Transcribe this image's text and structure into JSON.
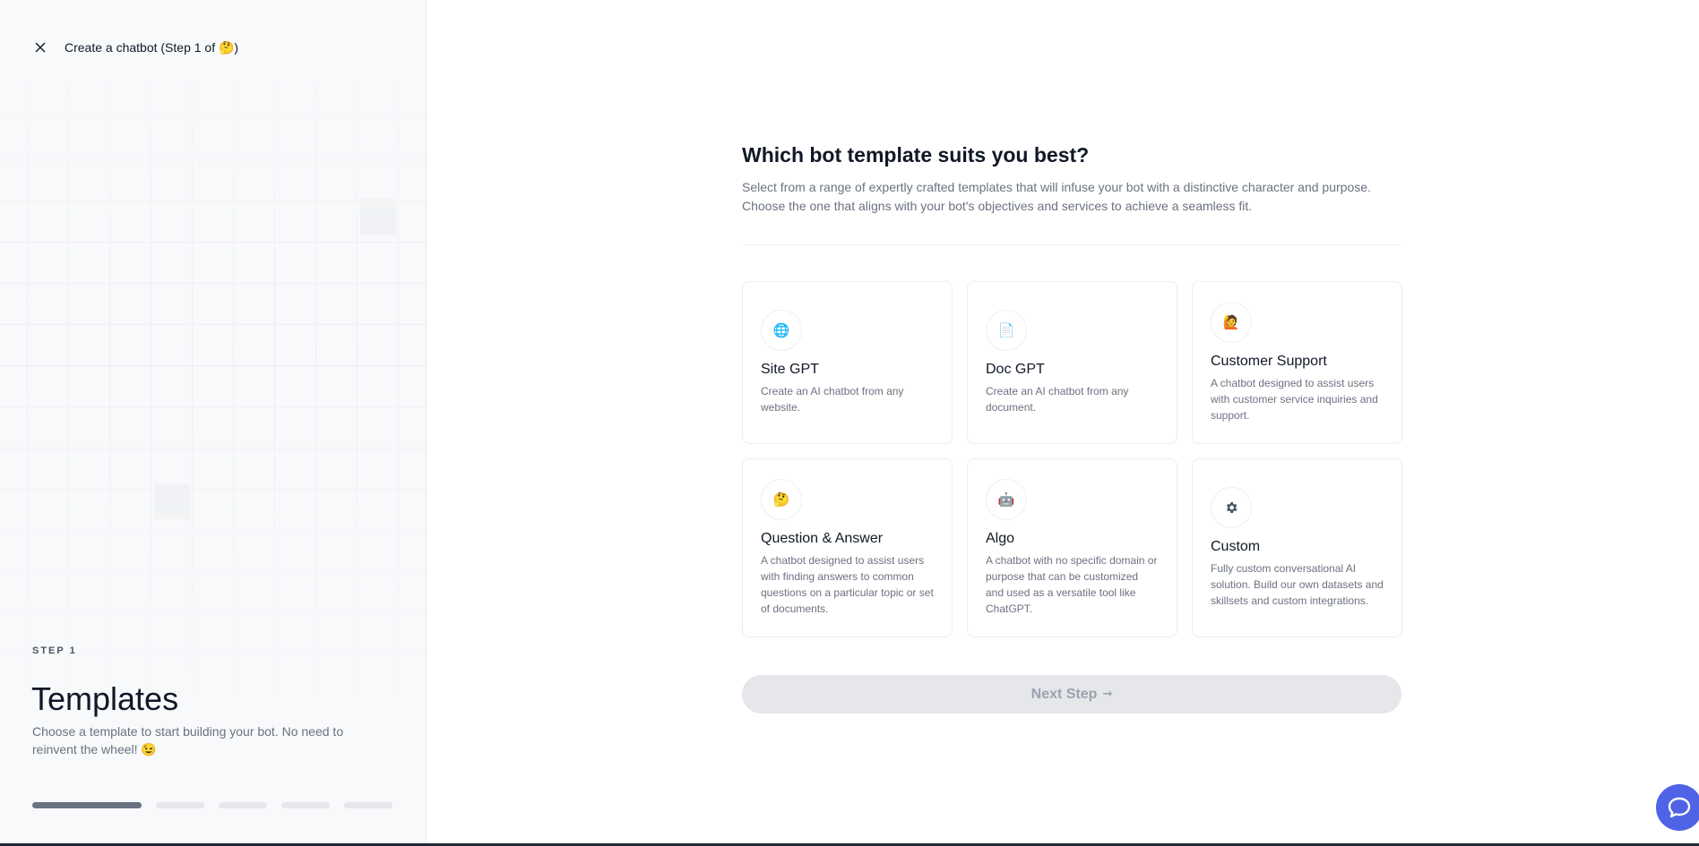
{
  "header": {
    "title": "Create a chatbot (Step 1 of 🤔)",
    "close_icon": "close-icon"
  },
  "left_panel": {
    "step_label": "STEP 1",
    "title": "Templates",
    "description": "Choose a template to start building your bot. No need to reinvent the wheel! 😉",
    "progress": {
      "total_steps": 5,
      "current_step": 1
    }
  },
  "main": {
    "title": "Which bot template suits you best?",
    "description_line1": "Select from a range of expertly crafted templates that will infuse your bot with a distinctive character and purpose.",
    "description_line2": "Choose the one that aligns with your bot's objectives and services to achieve a seamless fit.",
    "templates": [
      {
        "title": "Site GPT",
        "description": "Create an AI chatbot from any website.",
        "icon": "globe-icon",
        "glyph": "🌐"
      },
      {
        "title": "Doc GPT",
        "description": "Create an AI chatbot from any document.",
        "icon": "document-icon",
        "glyph": "📄"
      },
      {
        "title": "Customer Support",
        "description": "A chatbot designed to assist users with customer service inquiries and support.",
        "icon": "support-agent-icon",
        "glyph": "🙋"
      },
      {
        "title": "Question & Answer",
        "description": "A chatbot designed to assist users with finding answers to common questions on a particular topic or set of documents.",
        "icon": "thinking-face-icon",
        "glyph": "🤔"
      },
      {
        "title": "Algo",
        "description": "A chatbot with no specific domain or purpose that can be customized and used as a versatile tool like ChatGPT.",
        "icon": "robot-icon",
        "glyph": "🤖"
      },
      {
        "title": "Custom",
        "description": "Fully custom conversational AI solution. Build our own datasets and skillsets and custom integrations.",
        "icon": "gear-icon",
        "glyph": "⚙"
      }
    ],
    "next_button": "Next Step",
    "next_arrow": "→"
  },
  "colors": {
    "accent": "#4f63e6",
    "progress_active": "#6b7280",
    "progress_inactive": "#e5e7eb",
    "button_disabled_bg": "#e5e7eb"
  }
}
